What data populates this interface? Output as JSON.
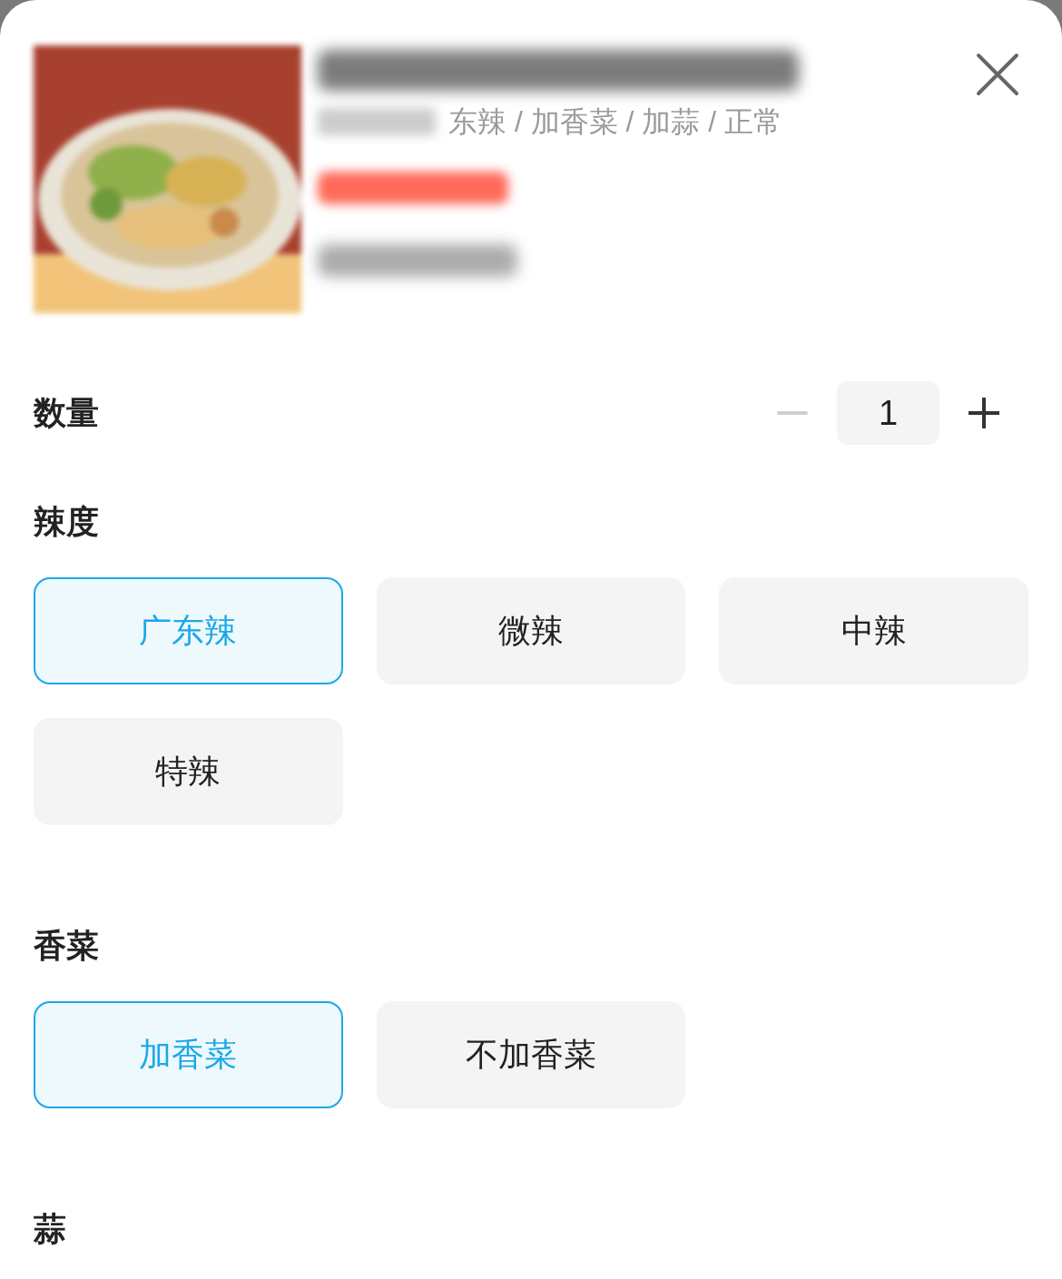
{
  "product": {
    "options_summary": "东辣 / 加香菜 / 加蒜 / 正常"
  },
  "quantity": {
    "label": "数量",
    "value": "1",
    "decrement_disabled": true
  },
  "groups": [
    {
      "title": "辣度",
      "options": [
        {
          "label": "广东辣",
          "selected": true
        },
        {
          "label": "微辣",
          "selected": false
        },
        {
          "label": "中辣",
          "selected": false
        },
        {
          "label": "特辣",
          "selected": false
        }
      ]
    },
    {
      "title": "香菜",
      "options": [
        {
          "label": "加香菜",
          "selected": true
        },
        {
          "label": "不加香菜",
          "selected": false
        }
      ]
    },
    {
      "title": "蒜"
    }
  ]
}
